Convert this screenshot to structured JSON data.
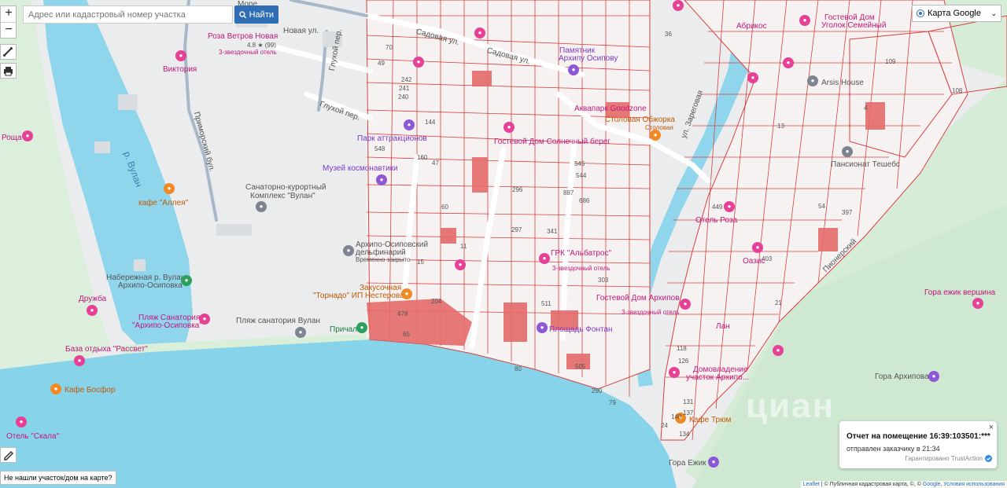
{
  "search": {
    "placeholder": "Адрес или кадастровый номер участка",
    "button_label": "Найти"
  },
  "zoom": {
    "in_label": "+",
    "out_label": "−"
  },
  "layer": {
    "selected": "Карта Google"
  },
  "notification": {
    "title": "Отчет на помещение 16:39:103501:***",
    "subtitle": "отправлен заказчику в 21:34",
    "guarantee": "Гарантировано TrustAction"
  },
  "not_found_label": "Не нашли участок/дом на карте?",
  "attribution": {
    "leaflet": "Leaflet",
    "sep1": " | © ",
    "cadastral": "Публичная кадастровая карта",
    "sep2": ", ©, © ",
    "google": "Google",
    "sep3": ", ",
    "terms": "Условия использования"
  },
  "watermark": "циан",
  "map_labels": {
    "river": "р. Вулан",
    "street_novaya": "Новая ул.",
    "street_glukhoy1": "Глухой пер.",
    "street_glukhoy2": "Глухой пер.",
    "street_sadovaya1": "Садовая ул.",
    "street_sadovaya2": "Садовая ул.",
    "street_primorsky": "Приморский бул.",
    "street_zaregovaya": "ул. Зареговая",
    "street_pionerskiy": "Пионерский",
    "more": "Море",
    "roza_vetrov": "Роза Ветров Новая",
    "roza_rating": "4.8 ★ (99)",
    "roza_stars": "3-звездочный отель",
    "viktoriya": "Виктория",
    "roshcha": "Роща",
    "kafe_alleya": "кафе \"Аллея\"",
    "sanatoriy": "Санаторно-курортный",
    "sanatoriy2": "Комплекс \"Вулан\"",
    "naberezhnaya": "Набережная р. Вулан",
    "naberezhnaya2": "Архипо-Осиповка",
    "druzhba": "Дружба",
    "plyazh_sanatoria": "Пляж Санатория",
    "plyazh_sanatoria2": "\"Архипо-Осиповка\"",
    "plyazh_vulan": "Пляж санатория Вулан",
    "baza_rassvet": "База отдыха \"Рассвет\"",
    "kafe_bosfor": "Кафе Босфор",
    "otel_skala": "Отель \"Скала\"",
    "prichal": "Причал",
    "tornado": "\"Торнадо\" ИП Нестерова",
    "zakusochnaya": "Закусочная",
    "delfinariy": "Архипо-Осиповский",
    "delfinariy2": "дельфинарий",
    "delfinariy3": "Временно закрыто",
    "muzey": "Музей космонавтики",
    "park": "Парк аттракционов",
    "pamyatnik": "Памятник",
    "pamyatnik2": "Архипу Осипову",
    "akvapark": "Аквапарк Goodzone",
    "stolovaya": "Столовая Обжорка",
    "stolovaya2": "Столовая",
    "albatros": "ГРК \"Альбатрос\"",
    "albatros_stars": "3-звездочный отель",
    "fontan": "Площадь Фонтан",
    "gostevoy": "Гостевой Дом Архипов",
    "gostevoy_stars": "3-звездочный отель",
    "otel_rz": "Отель Роза",
    "oazis": "Оазис",
    "lan_hotel": "Лан",
    "gora_ezhik_vershina": "Гора ежик вершина",
    "gora_arkhipova": "Гора Архипова",
    "gora_ezhik": "Гора Ежик",
    "kafe_tryum": "Кафе Трюм",
    "domovladenie": "Домовладение",
    "domovladenie2": "участок Архипо...",
    "arsis": "Arsis House",
    "tesheba": "Пансионат Тешебс",
    "abrikos": "Абрикос",
    "semeyniy": "Гостевой Дом",
    "semeyniy2": "Уголок Семейный",
    "solnechniy": "Гостевой Дом Солнечный берег"
  },
  "parcel_numbers": [
    "548",
    "47",
    "60",
    "15",
    "11",
    "65",
    "478",
    "204",
    "80",
    "79",
    "290",
    "505",
    "511",
    "303",
    "21",
    "4",
    "109",
    "108",
    "36",
    "118",
    "126",
    "131",
    "137",
    "134",
    "140",
    "24",
    "13",
    "397",
    "54",
    "403",
    "449",
    "545",
    "544",
    "296",
    "297",
    "341",
    "887",
    "686",
    "242",
    "241",
    "240",
    "160",
    "144",
    "49",
    "70"
  ]
}
